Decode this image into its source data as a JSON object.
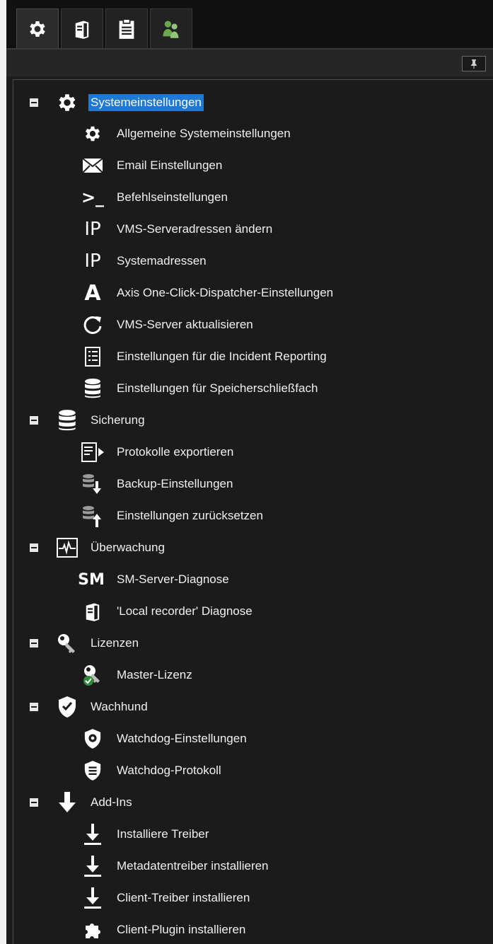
{
  "tabs": [
    {
      "icon": "gear-icon",
      "active": true
    },
    {
      "icon": "server-icon",
      "active": false
    },
    {
      "icon": "clipboard-icon",
      "active": false
    },
    {
      "icon": "users-icon",
      "active": false
    }
  ],
  "toolbar": {
    "button_icon": "pin-icon"
  },
  "tree": {
    "systemeinstellungen": {
      "label": "Systemeinstellungen",
      "children": {
        "allgemeine": "Allgemeine Systemeinstellungen",
        "email": "Email Einstellungen",
        "befehl": "Befehlseinstellungen",
        "vms_adressen": "VMS-Serveradressen ändern",
        "systemadressen": "Systemadressen",
        "axis": "Axis One-Click-Dispatcher-Einstellungen",
        "vms_update": "VMS-Server aktualisieren",
        "incident": "Einstellungen für die Incident Reporting",
        "speicher": "Einstellungen für Speicherschließfach"
      }
    },
    "sicherung": {
      "label": "Sicherung",
      "children": {
        "protokolle": "Protokolle exportieren",
        "backup": "Backup-Einstellungen",
        "reset": "Einstellungen zurücksetzen"
      }
    },
    "ueberwachung": {
      "label": "Überwachung",
      "children": {
        "sm_diag": "SM-Server-Diagnose",
        "local_diag": "'Local recorder' Diagnose"
      }
    },
    "lizenzen": {
      "label": "Lizenzen",
      "children": {
        "master": "Master-Lizenz"
      }
    },
    "wachhund": {
      "label": "Wachhund",
      "children": {
        "wd_settings": "Watchdog-Einstellungen",
        "wd_log": "Watchdog-Protokoll"
      }
    },
    "addins": {
      "label": "Add-Ins",
      "children": {
        "treiber": "Installiere Treiber",
        "meta": "Metadatentreiber installieren",
        "client_treiber": "Client-Treiber installieren",
        "plugin": "Client-Plugin installieren"
      }
    }
  },
  "text_icons": {
    "ip": "IP",
    "sm": "SM",
    "axis": "A",
    "prompt": ">_"
  }
}
